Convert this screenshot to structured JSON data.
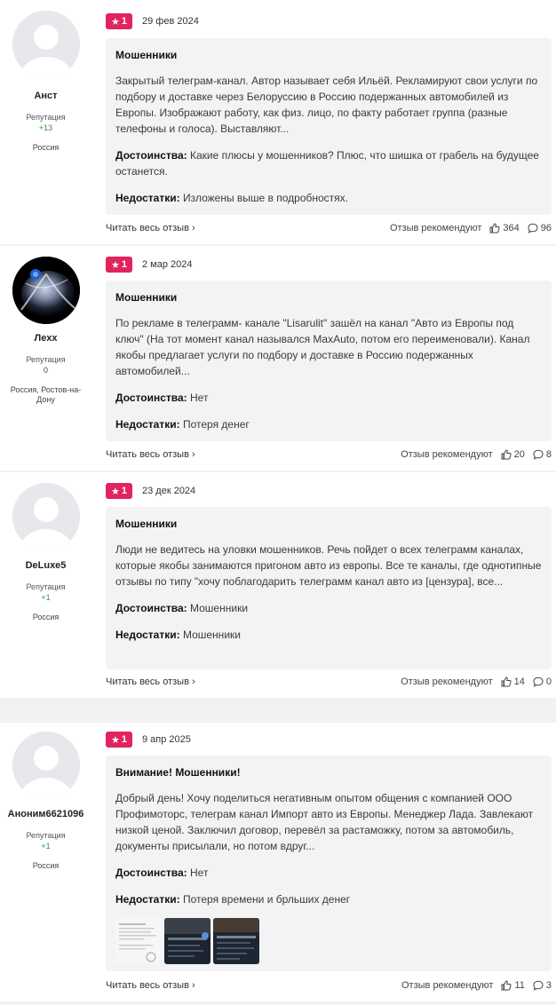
{
  "labels": {
    "reputation": "Репутация",
    "read_all": "Читать весь отзыв",
    "recommend": "Отзыв рекомендуют",
    "pros": "Достоинства:",
    "cons": "Недостатки:"
  },
  "reviews": [
    {
      "user": "Анст",
      "reputation": "+13",
      "location": "Россия",
      "rating": "1",
      "date": "29 фев 2024",
      "title": "Мошенники",
      "text": "Закрытый телеграм-канал. Автор называет себя Ильёй. Рекламируют свои услуги по подбору и доставке через Белоруссию в Россию подержанных автомобилей из Европы. Изображают работу, как физ. лицо, по факту работает группа (разные телефоны и голоса). Выставляют...",
      "pros": "Какие плюсы у мошенников? Плюс, что шишка от грабель на будущее останется.",
      "cons": "Изложены выше в подробностях.",
      "likes": "364",
      "comments": "96"
    },
    {
      "user": "Лехх",
      "reputation": "0",
      "location": "Россия, Ростов-на-Дону",
      "rating": "1",
      "date": "2 мар 2024",
      "title": "Мошенники",
      "text": "По рекламе в телеграмм- канале \"Lisarulit\" зашёл на канал \"Авто из Европы под ключ\" (На тот момент канал назывался MaxAuto, потом его переименовали). Канал якобы предлагает услуги по подбору и доставке в Россию подержанных автомобилей...",
      "pros": "Нет",
      "cons": "Потеря денег",
      "likes": "20",
      "comments": "8"
    },
    {
      "user": "DeLuxe5",
      "reputation": "+1",
      "location": "Россия",
      "rating": "1",
      "date": "23 дек 2024",
      "title": "Мошенники",
      "text": "Люди не ведитесь на уловки мошенников. Речь пойдет о всех телеграмм каналах, которые якобы занимаются пригоном авто из европы. Все те каналы, где однотипные отзывы по типу \"хочу поблагодарить телеграмм канал авто из [цензура], все...",
      "pros": "Мошенники",
      "cons": "Мошенники",
      "likes": "14",
      "comments": "0"
    },
    {
      "user": "Аноним6621096",
      "reputation": "+1",
      "location": "Россия",
      "rating": "1",
      "date": "9 апр 2025",
      "title": "Внимание! Мошенники!",
      "text": "Добрый день! Хочу поделиться негативным опытом общения с компанией ООО Профимоторс, телеграм канал Импорт авто из Европы. Менеджер Лада. Завлекают низкой ценой. Заключил договор, перевёл за растаможку, потом за автомобиль, документы присылали, но потом вдруг...",
      "pros": "Нет",
      "cons": "Потеря времени и брльших денег",
      "likes": "11",
      "comments": "3"
    }
  ],
  "colors": {
    "rating_badge": "#e0245e",
    "card_bg": "#f3f3f5",
    "reputation_positive": "#2e9a2e",
    "separator": "#f2f2f4"
  }
}
